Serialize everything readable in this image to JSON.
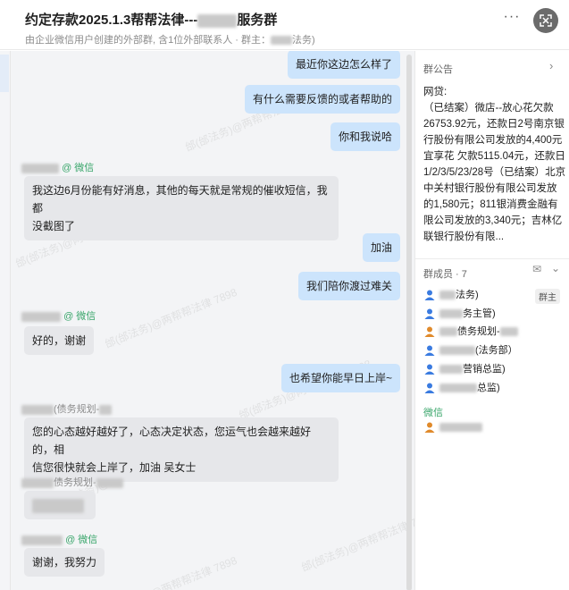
{
  "header": {
    "title": "约定存款2025.1.3帮帮法律---",
    "title_suffix": "服务群",
    "subtitle": "由企业微信用户创建的外部群, 含1位外部联系人 · 群主：",
    "subtitle_suffix": "法务)"
  },
  "watermark": "邰(邰法务)@两帮帮法律 7898",
  "messages": [
    {
      "dir": "out",
      "text": "最近你这边怎么样了"
    },
    {
      "dir": "out",
      "text": "有什么需要反馈的或者帮助的"
    },
    {
      "dir": "out",
      "text": "你和我说哈"
    },
    {
      "dir": "in",
      "sender_tag": "@ 微信",
      "lines": [
        "我这边6月份能有好消息，其他的每天就是常规的催收短信，我都",
        "没截图了"
      ]
    },
    {
      "dir": "out",
      "text": "加油"
    },
    {
      "dir": "out",
      "text": "我们陪你渡过难关"
    },
    {
      "dir": "in",
      "sender_tag": "@ 微信",
      "lines": [
        "好的，谢谢"
      ]
    },
    {
      "dir": "out",
      "text": "也希望你能早日上岸~"
    },
    {
      "dir": "in",
      "sender_name": "(债务规划-",
      "lines": [
        "您的心态越好越好了，心态决定状态，您运气也会越来越好的，相",
        "信您很快就会上岸了，加油  吴女士"
      ]
    },
    {
      "dir": "in",
      "sender_name": "债务规划-",
      "lines": [
        ""
      ]
    },
    {
      "dir": "in",
      "sender_tag": "@ 微信",
      "lines": [
        "谢谢，我努力"
      ]
    }
  ],
  "panel": {
    "notice_title": "群公告",
    "notice_lines": [
      "网贷:",
      "（已结案）微店--放心花欠款26753.92元，还款日2号南京银行股份有限公司发放的4,400元",
      "宜享花 欠款5115.04元，还款日1/2/3/5/23/28号（已结案）北京中关村银行股份有限公司发放的1,580元；811银消费金融有限公司发放的3,340元；吉林亿联银行股份有限..."
    ],
    "members_title": "群成员 · 7",
    "members": [
      {
        "name": "法务)",
        "badge": "群主",
        "color": "#3a7be0"
      },
      {
        "name": "务主管)",
        "color": "#3a7be0"
      },
      {
        "name": "债务规划-",
        "color": "#e08a2b"
      },
      {
        "name": "(法务部）",
        "color": "#3a7be0"
      },
      {
        "name": "营销总监)",
        "color": "#3a7be0"
      },
      {
        "name": "总监)",
        "color": "#3a7be0"
      }
    ],
    "wechat_label": "微信",
    "wechat_members": [
      {
        "name": "",
        "color": "#e08a2b"
      }
    ]
  }
}
